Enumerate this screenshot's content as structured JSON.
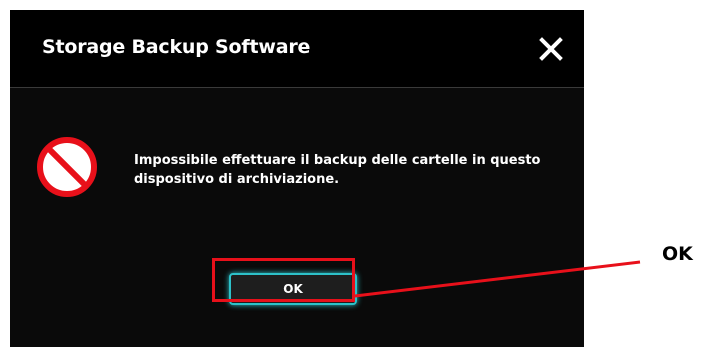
{
  "dialog": {
    "title": "Storage Backup Software",
    "close_icon": "close-icon",
    "error_icon": "prohibited-icon",
    "message": "Impossibile effettuare il backup delle cartelle in questo dispositivo di archiviazione.",
    "ok_label": "OK"
  },
  "annotation": {
    "label": "OK",
    "color": "#e8101a"
  },
  "colors": {
    "dialog_background": "#0a0a0a",
    "button_border": "#2dc1c9",
    "error_red": "#e8101a"
  }
}
